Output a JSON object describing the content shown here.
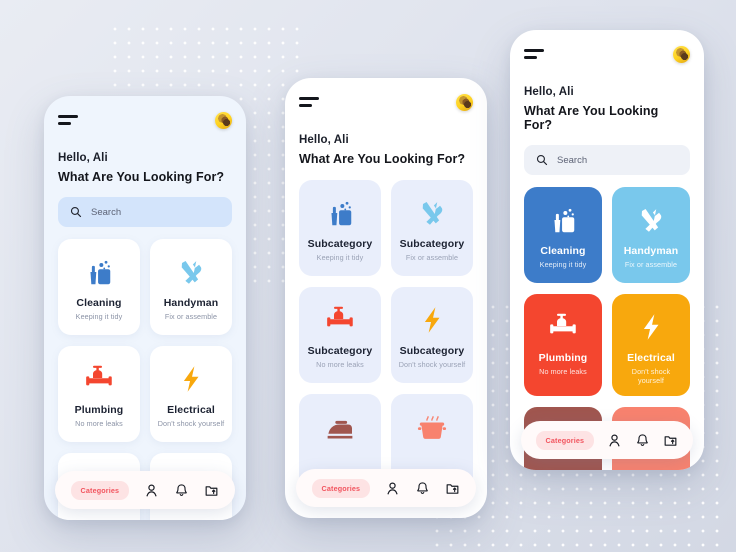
{
  "app": {
    "greeting": "Hello, Ali",
    "question": "What Are You Looking For?",
    "search_placeholder": "Search",
    "menu_icon": "hamburger-icon",
    "avatar_icon": "user-avatar"
  },
  "search": {
    "placeholder": "Search"
  },
  "bottom_nav": {
    "categories_label": "Categories",
    "items": [
      {
        "icon": "person-icon"
      },
      {
        "icon": "bell-icon"
      },
      {
        "icon": "folder-upload-icon"
      }
    ]
  },
  "colors": {
    "background": "#dfe3ed",
    "dot": "#ffffff",
    "search_blue": "#d3e4fb",
    "search_gray": "#eef1f7",
    "card_soft": "#e9eefb",
    "pill_bg": "#fde3e4",
    "pill_text": "#f2555f",
    "cleaning": "#3d7cc9",
    "handyman": "#79c8ec",
    "plumbing": "#f4462f",
    "electrical": "#f8a80d",
    "laundry": "#a0564f",
    "cooking": "#f8826e"
  },
  "screens": {
    "left": {
      "cards": [
        {
          "title": "Cleaning",
          "subtitle": "Keeping it tidy",
          "icon": "cleaning-bucket-icon",
          "color": "#3d7cc9"
        },
        {
          "title": "Handyman",
          "subtitle": "Fix or assemble",
          "icon": "tools-wrench-icon",
          "color": "#79c8ec"
        },
        {
          "title": "Plumbing",
          "subtitle": "No more leaks",
          "icon": "pipe-valve-icon",
          "color": "#f4462f"
        },
        {
          "title": "Electrical",
          "subtitle": "Don't shock yourself",
          "icon": "lightning-bolt-icon",
          "color": "#f8a80d"
        },
        {
          "title": "",
          "subtitle": "",
          "icon": "iron-icon",
          "color": "#a0564f"
        },
        {
          "title": "",
          "subtitle": "",
          "icon": "cooking-pot-icon",
          "color": "#f8826e"
        }
      ]
    },
    "middle": {
      "cards": [
        {
          "title": "Subcategory",
          "subtitle": "Keeping it tidy",
          "icon": "cleaning-bucket-icon",
          "color": "#3d7cc9"
        },
        {
          "title": "Subcategory",
          "subtitle": "Fix or assemble",
          "icon": "tools-wrench-icon",
          "color": "#79c8ec"
        },
        {
          "title": "Subcategory",
          "subtitle": "No more leaks",
          "icon": "pipe-valve-icon",
          "color": "#f4462f"
        },
        {
          "title": "Subcategory",
          "subtitle": "Don't shock yourself",
          "icon": "lightning-bolt-icon",
          "color": "#f8a80d"
        },
        {
          "title": "",
          "subtitle": "",
          "icon": "iron-icon",
          "color": "#a0564f"
        },
        {
          "title": "",
          "subtitle": "",
          "icon": "cooking-pot-icon",
          "color": "#f8826e"
        }
      ]
    },
    "right": {
      "cards": [
        {
          "title": "Cleaning",
          "subtitle": "Keeping it tidy",
          "icon": "cleaning-bucket-icon",
          "color": "#3d7cc9"
        },
        {
          "title": "Handyman",
          "subtitle": "Fix or assemble",
          "icon": "tools-wrench-icon",
          "color": "#79c8ec"
        },
        {
          "title": "Plumbing",
          "subtitle": "No more leaks",
          "icon": "pipe-valve-icon",
          "color": "#f4462f"
        },
        {
          "title": "Electrical",
          "subtitle": "Don't shock yourself",
          "icon": "lightning-bolt-icon",
          "color": "#f8a80d"
        },
        {
          "title": "",
          "subtitle": "",
          "icon": "iron-icon",
          "color": "#a0564f"
        },
        {
          "title": "",
          "subtitle": "",
          "icon": "cooking-pot-icon",
          "color": "#f8826e"
        }
      ]
    }
  }
}
